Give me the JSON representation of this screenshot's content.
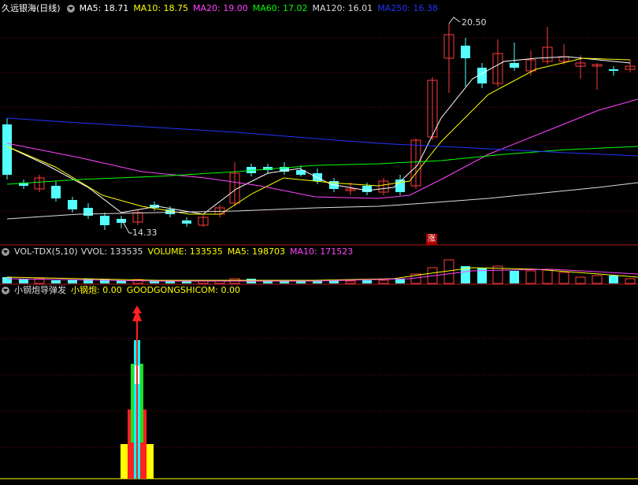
{
  "main": {
    "title": "久远银海(日线)",
    "ma": [
      {
        "label": "MA5: 18.71",
        "color": "#ffffff"
      },
      {
        "label": "MA10: 18.75",
        "color": "#ffff00"
      },
      {
        "label": "MA20: 19.00",
        "color": "#ff44ff"
      },
      {
        "label": "MA60: 17.02",
        "color": "#00ff00"
      },
      {
        "label": "MA120: 16.01",
        "color": "#dddddd"
      },
      {
        "label": "MA250: 16.38",
        "color": "#2233ff"
      }
    ],
    "high_label": "20.50",
    "low_label": "14.33",
    "limit_badge": "涨"
  },
  "volume": {
    "title": "VOL-TDX(5,10)",
    "vol_label": "VVOL: 133535",
    "volume_label": "VOLUME: 133535",
    "ma5_label": "MA5: 198703",
    "ma10_label": "MA10: 171523"
  },
  "indicator": {
    "title": "小钢炮导弹发",
    "value_label": "小钢炮: 0.00",
    "site_label": "GOODGONGSHICOM: 0.00"
  },
  "colors": {
    "up": "#ff3c3c",
    "down": "#54ffff",
    "grid": "#7a1010",
    "separator": "#b01c1c"
  }
}
